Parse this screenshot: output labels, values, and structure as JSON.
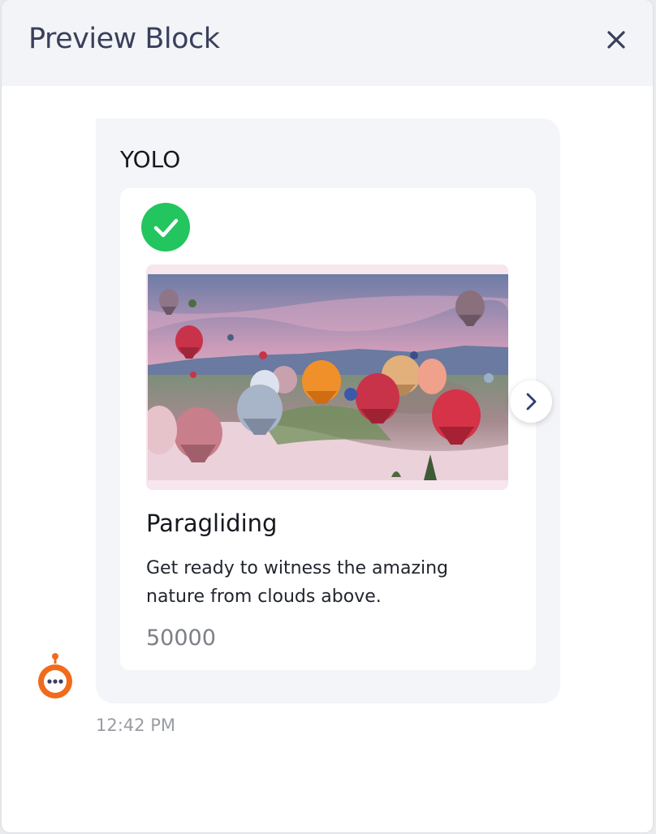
{
  "modal": {
    "title": "Preview Block",
    "close_icon": "close-icon"
  },
  "message": {
    "title": "YOLO",
    "timestamp": "12:42 PM",
    "avatar_icon": "chatbot-icon",
    "card": {
      "status_icon": "check-circle-icon",
      "image_subject": "hot-air-balloons-landscape",
      "next_icon": "chevron-right-icon",
      "title": "Paragliding",
      "description": "Get ready to witness the amazing nature from clouds above.",
      "price": "50000"
    }
  },
  "colors": {
    "header_bg": "#f3f4f7",
    "title_text": "#3a3f5c",
    "bubble_bg": "#f4f5f8",
    "success": "#22c55e",
    "bot_orange": "#f26a1b",
    "chevron": "#2f3d6e",
    "muted_text": "#9a9ca3"
  }
}
